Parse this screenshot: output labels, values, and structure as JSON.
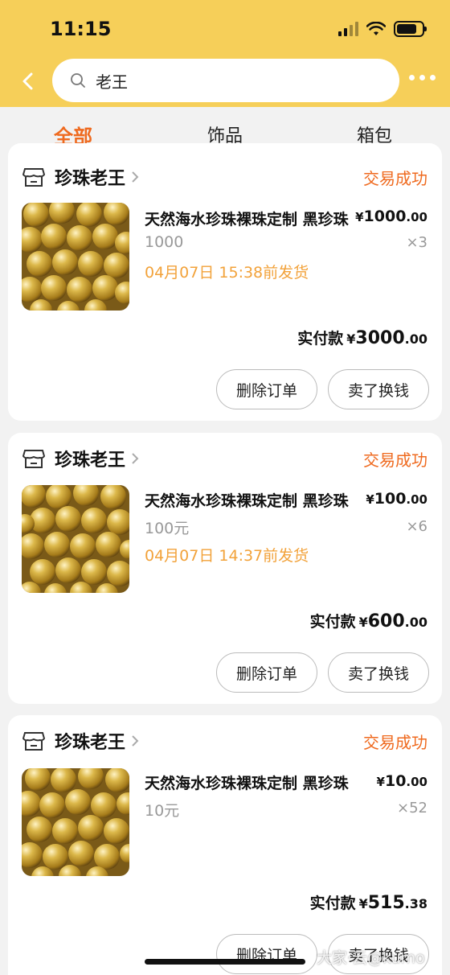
{
  "status_bar": {
    "time": "11:15"
  },
  "search": {
    "value": "老王"
  },
  "tabs": [
    {
      "label": "全部",
      "active": true
    },
    {
      "label": "饰品",
      "active": false
    },
    {
      "label": "箱包",
      "active": false
    }
  ],
  "orders": [
    {
      "shop": "珍珠老王",
      "status": "交易成功",
      "title": "天然海水珍珠裸珠定制 黑珍珠",
      "price_symbol": "¥",
      "price_int": "1000",
      "price_dec": ".00",
      "sku": "1000",
      "qty": "×3",
      "ship": "04月07日 15:38前发货",
      "total_label": "实付款",
      "total_symbol": "¥",
      "total_int": "3000",
      "total_dec": ".00",
      "btn_delete": "删除订单",
      "btn_sell": "卖了换钱"
    },
    {
      "shop": "珍珠老王",
      "status": "交易成功",
      "title": "天然海水珍珠裸珠定制 黑珍珠",
      "price_symbol": "¥",
      "price_int": "100",
      "price_dec": ".00",
      "sku": "100元",
      "qty": "×6",
      "ship": "04月07日 14:37前发货",
      "total_label": "实付款",
      "total_symbol": "¥",
      "total_int": "600",
      "total_dec": ".00",
      "btn_delete": "删除订单",
      "btn_sell": "卖了换钱"
    },
    {
      "shop": "珍珠老王",
      "status": "交易成功",
      "title": "天然海水珍珠裸珠定制 黑珍珠",
      "price_symbol": "¥",
      "price_int": "10",
      "price_dec": ".00",
      "sku": "10元",
      "qty": "×52",
      "ship": "",
      "total_label": "实付款",
      "total_symbol": "¥",
      "total_int": "515",
      "total_dec": ".38",
      "btn_delete": "删除订单",
      "btn_sell": "卖了换钱"
    }
  ],
  "watermark": "大家·云@kumo",
  "colors": {
    "header_yellow": "#f6cf59",
    "accent_orange": "#ef6a1f",
    "ship_orange": "#f2a23a",
    "gold": "#c9a22e"
  }
}
